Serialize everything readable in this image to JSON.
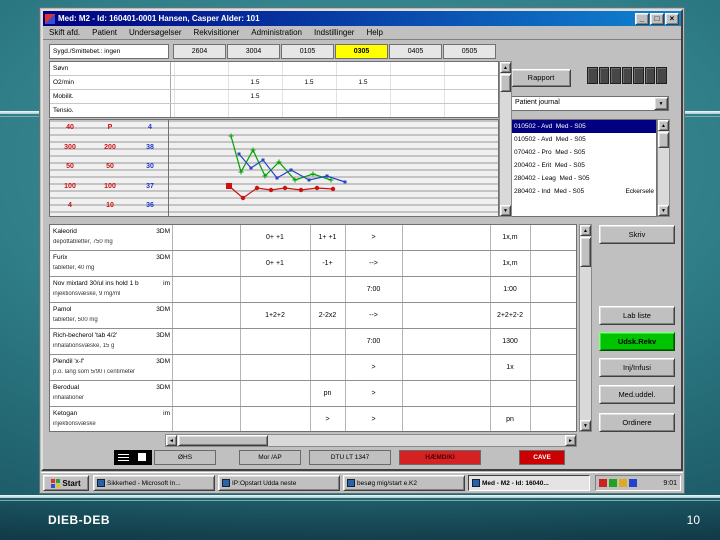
{
  "slide": {
    "footer_left": "DIEB-DEB",
    "page_number": "10"
  },
  "colors": {
    "highlight": "#ffff00",
    "selection": "#000080",
    "alert": "#cc0000",
    "action_green": "#00c400",
    "titlebar": "#000080"
  },
  "window": {
    "title": "Med: M2 - Id: 160401-0001  Hansen, Casper   Alder: 101",
    "window_buttons": {
      "minimize": "_",
      "maximize": "□",
      "close": "×"
    },
    "menu": [
      "Skift afd.",
      "Patient",
      "Undersøgelser",
      "Rekvisitioner",
      "Administration",
      "Indstillinger",
      "Help"
    ],
    "obs": {
      "label": "Sygd./Smittebet.: ingen",
      "date_columns": [
        "2604",
        "3004",
        "0105",
        "0305",
        "0405",
        "0505"
      ],
      "highlighted_column": 3,
      "rows": [
        {
          "label": "Søvn",
          "values": [
            "",
            "",
            "",
            "",
            "",
            ""
          ]
        },
        {
          "label": "O2/min",
          "values": [
            "",
            "1.5",
            "1.5",
            "1.5",
            "",
            ""
          ]
        },
        {
          "label": "Mobilit.",
          "values": [
            "",
            "1.5",
            "",
            "",
            "",
            ""
          ]
        },
        {
          "label": "Tensio.",
          "values": [
            "",
            "",
            "",
            "",
            "",
            ""
          ]
        }
      ]
    },
    "rapport_button": "Rapport",
    "journal_select": "Patient journal",
    "vitals_scale": {
      "column_colors": [
        "#cc1111",
        "#cc1111",
        "#2233cc"
      ],
      "rows": [
        [
          "40",
          "P",
          "4"
        ],
        [
          "300",
          "200",
          "38"
        ],
        [
          "50",
          "50",
          "30"
        ],
        [
          "100",
          "100",
          "37"
        ],
        [
          "4",
          "10",
          "36"
        ]
      ]
    },
    "chart_data": {
      "type": "line",
      "series": [
        {
          "name": "temperature",
          "color": "#00a000",
          "marker": "cross",
          "points": [
            [
              62,
              16
            ],
            [
              72,
              52
            ],
            [
              84,
              30
            ],
            [
              96,
              56
            ],
            [
              110,
              42
            ],
            [
              126,
              60
            ],
            [
              144,
              54
            ],
            [
              162,
              60
            ]
          ]
        },
        {
          "name": "pulse",
          "color": "#2844c8",
          "marker": "square",
          "points": [
            [
              70,
              34
            ],
            [
              82,
              48
            ],
            [
              94,
              40
            ],
            [
              108,
              58
            ],
            [
              122,
              50
            ],
            [
              140,
              60
            ],
            [
              158,
              56
            ],
            [
              176,
              62
            ]
          ]
        },
        {
          "name": "blood-pressure",
          "color": "#cc1111",
          "marker": "dot",
          "start_square": true,
          "points": [
            [
              60,
              66
            ],
            [
              74,
              78
            ],
            [
              88,
              68
            ],
            [
              102,
              70
            ],
            [
              116,
              68
            ],
            [
              132,
              70
            ],
            [
              148,
              68
            ],
            [
              164,
              69
            ]
          ]
        }
      ]
    },
    "journal_list": [
      {
        "date": "010502",
        "kind": "Avd",
        "dept": "Med",
        "code": "S05",
        "selected": true
      },
      {
        "date": "010502",
        "kind": "Avd",
        "dept": "Med",
        "code": "S05"
      },
      {
        "date": "070402",
        "kind": "Pro",
        "dept": "Med",
        "code": "S05"
      },
      {
        "date": "200402",
        "kind": "Erit",
        "dept": "Med",
        "code": "S05"
      },
      {
        "date": "280402",
        "kind": "Leag",
        "dept": "Med",
        "code": "S05"
      },
      {
        "date": "280402",
        "kind": "Ind",
        "dept": "Med",
        "code": "S05",
        "note": "Eckersele"
      }
    ],
    "medications": [
      {
        "name": "Kaleorid",
        "form": "3DM",
        "desc": "depottabletter, 750 mg",
        "b": "0+ +1",
        "c": "1+ +1",
        "d": ">",
        "freq": "1x,m"
      },
      {
        "name": "Furix",
        "form": "3DM",
        "desc": "tabletter, 40 mg",
        "b": "0+ +1",
        "c": "-1+",
        "d": "-->",
        "freq": "1x,m"
      },
      {
        "name": "Nov mixtard 30/ul ins hold 1 b",
        "form": "im",
        "desc": "injektionsvæske, 9 mg/ml",
        "b": "",
        "c": "",
        "d": "7:00",
        "freq": "1:00"
      },
      {
        "name": "Pamol",
        "form": "3DM",
        "desc": "tabletter, 500 mg",
        "b": "1+2+2",
        "c": "2-2x2",
        "d": "-->",
        "freq": "2+2+2-2"
      },
      {
        "name": "Rich-becherol 'tab 4/2'",
        "form": "3DM",
        "desc": "inhalationsvæske, 15 g",
        "b": "",
        "c": "",
        "d": "7:00",
        "freq": "1300"
      },
      {
        "name": "Plendil 'x-f'",
        "form": "3DM",
        "desc": "p.o. lang som 5/90 i centimeter",
        "b": "",
        "c": "",
        "d": ">",
        "freq": "1x"
      },
      {
        "name": "Berodual",
        "form": "3DM",
        "desc": "inhalationer",
        "b": "",
        "c": "pn",
        "d": ">",
        "freq": ""
      },
      {
        "name": "Ketogan",
        "form": "im",
        "desc": "injektionsvæske",
        "b": "",
        "c": ">",
        "d": ">",
        "freq": "pn"
      }
    ],
    "side_buttons": [
      {
        "label": "Skriv"
      },
      {
        "label": "Lab liste"
      },
      {
        "label": "Udsk.Rekv",
        "green": true
      },
      {
        "label": "Inj/Infusi"
      },
      {
        "label": "Med.uddel."
      },
      {
        "label": "Ordinere"
      }
    ],
    "bottom_cells": [
      {
        "text": "ØHS"
      },
      {
        "text": "Mor /AP"
      },
      {
        "text": "DTU LT 1347"
      },
      {
        "text": "HÆMD/KI",
        "variant": "alert-dark"
      },
      {
        "text": "CAVE",
        "variant": "alert"
      }
    ]
  },
  "taskbar": {
    "start": "Start",
    "tasks": [
      {
        "label": "Sikkerhed - Microsoft In..."
      },
      {
        "label": "IP:Opstart Udda neste"
      },
      {
        "label": "besøg mig/start e.K2"
      },
      {
        "label": "Med - M2 - Id: 16040...",
        "active": true
      }
    ],
    "clock": "9:01"
  }
}
